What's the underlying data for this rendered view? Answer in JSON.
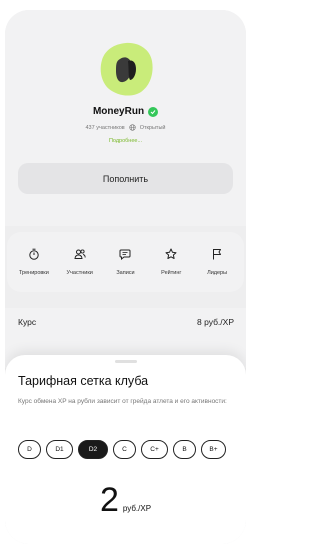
{
  "club": {
    "name": "MoneyRun",
    "members": "437 участников",
    "visibility": "Открытый",
    "more_link": "Подробнее...",
    "brand_color": "#c9ec7a"
  },
  "actions": {
    "topup_label": "Пополнить"
  },
  "nav": {
    "items": [
      {
        "label": "Тренировки",
        "icon": "stopwatch-icon"
      },
      {
        "label": "Участники",
        "icon": "users-icon"
      },
      {
        "label": "Записи",
        "icon": "chat-icon"
      },
      {
        "label": "Рейтинг",
        "icon": "star-icon"
      },
      {
        "label": "Лидеры",
        "icon": "flag-icon"
      }
    ]
  },
  "rate": {
    "label": "Курс",
    "value": "8 руб./XP"
  },
  "sheet": {
    "title": "Тарифная сетка клуба",
    "description": "Курс обмена XP на рубли зависит от грейда атлета и его активности:",
    "grades": [
      "D",
      "D1",
      "D2",
      "C",
      "C+",
      "B",
      "B+"
    ],
    "selected_grade": "D2",
    "rate_value": "2",
    "rate_unit": "руб./XP"
  }
}
